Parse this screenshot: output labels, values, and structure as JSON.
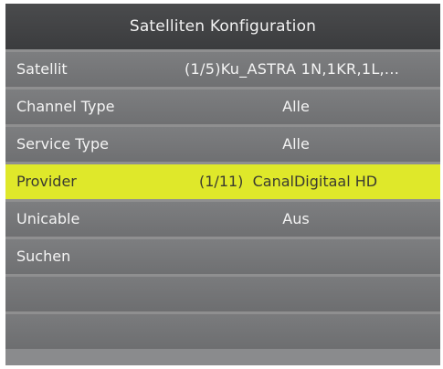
{
  "title": "Satelliten Konfiguration",
  "rows": [
    {
      "label": "Satellit",
      "index": "(1/5)",
      "value": "Ku_ASTRA 1N,1KR,1L,..."
    },
    {
      "label": "Channel Type",
      "value": "Alle"
    },
    {
      "label": "Service Type",
      "value": "Alle"
    },
    {
      "label": "Provider",
      "index": "(1/11)",
      "value": "CanalDigitaal HD"
    },
    {
      "label": "Unicable",
      "value": "Aus"
    },
    {
      "label": "Suchen",
      "value": ""
    }
  ],
  "colors": {
    "selected_row": "#dfe82a",
    "title_bar": "#444547",
    "row": "#767779"
  }
}
